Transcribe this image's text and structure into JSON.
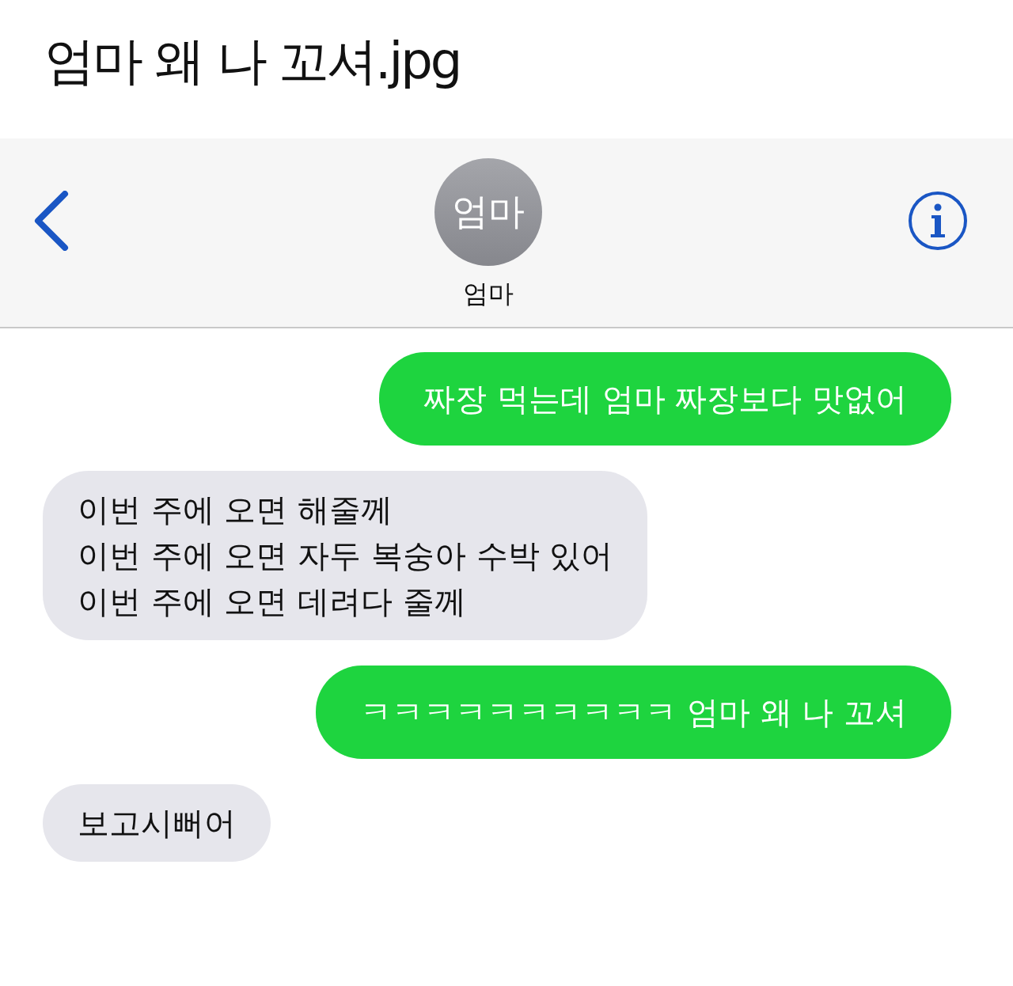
{
  "page_title": "엄마 왜 나 꼬셔.jpg",
  "header": {
    "avatar_text": "엄마",
    "contact_name": "엄마"
  },
  "messages": [
    {
      "kind": "sent",
      "lines": [
        "짜장 먹는데 엄마 짜장보다 맛없어"
      ]
    },
    {
      "kind": "received",
      "lines": [
        "이번 주에 오면 해줄께",
        "이번 주에 오면 자두 복숭아 수박 있어",
        "이번 주에 오면 데려다 줄께"
      ]
    },
    {
      "kind": "sent",
      "lines": [
        "ㅋㅋㅋㅋㅋㅋㅋㅋㅋㅋ 엄마 왜 나 꼬셔"
      ]
    },
    {
      "kind": "received",
      "lines": [
        "보고시뻐어"
      ]
    }
  ]
}
